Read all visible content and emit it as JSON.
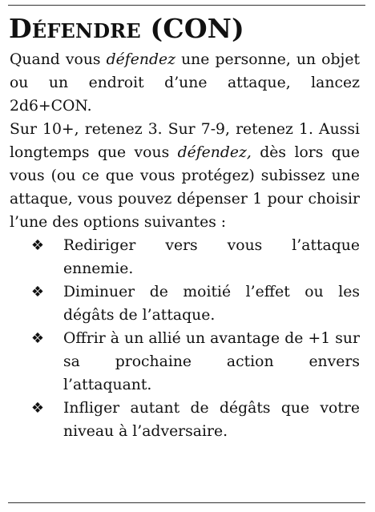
{
  "move": {
    "title_initial": "D",
    "title_rest": "éfendre",
    "title_stat": "(CON)"
  },
  "body": {
    "intro_before": "Quand vous ",
    "intro_em": "défendez",
    "intro_after": " une personne, un objet ou un endroit d’une attaque, lancez 2d6+CON.",
    "results_start": "Sur 10+, retenez 3. Sur 7-9, retenez 1. Aussi longtemps que vous ",
    "results_em": "défendez,",
    "results_end": " dès lors que vous (ou ce que vous protégez) subissez une attaque, vous pouvez dépenser 1 pour choisir l’une des options suivantes :"
  },
  "options": [
    {
      "icon": "four-diamond-bullet",
      "text": "Rediriger vers vous l’attaque ennemie."
    },
    {
      "icon": "four-diamond-bullet",
      "text": "Diminuer de moitié l’effet ou les dégâts de l’attaque."
    },
    {
      "icon": "four-diamond-bullet",
      "text": "Offrir à un allié un avantage de +1 sur sa prochaine action envers l’attaquant."
    },
    {
      "icon": "four-diamond-bullet",
      "text": "Infliger autant de dégâts que votre niveau à l’adversaire."
    }
  ]
}
